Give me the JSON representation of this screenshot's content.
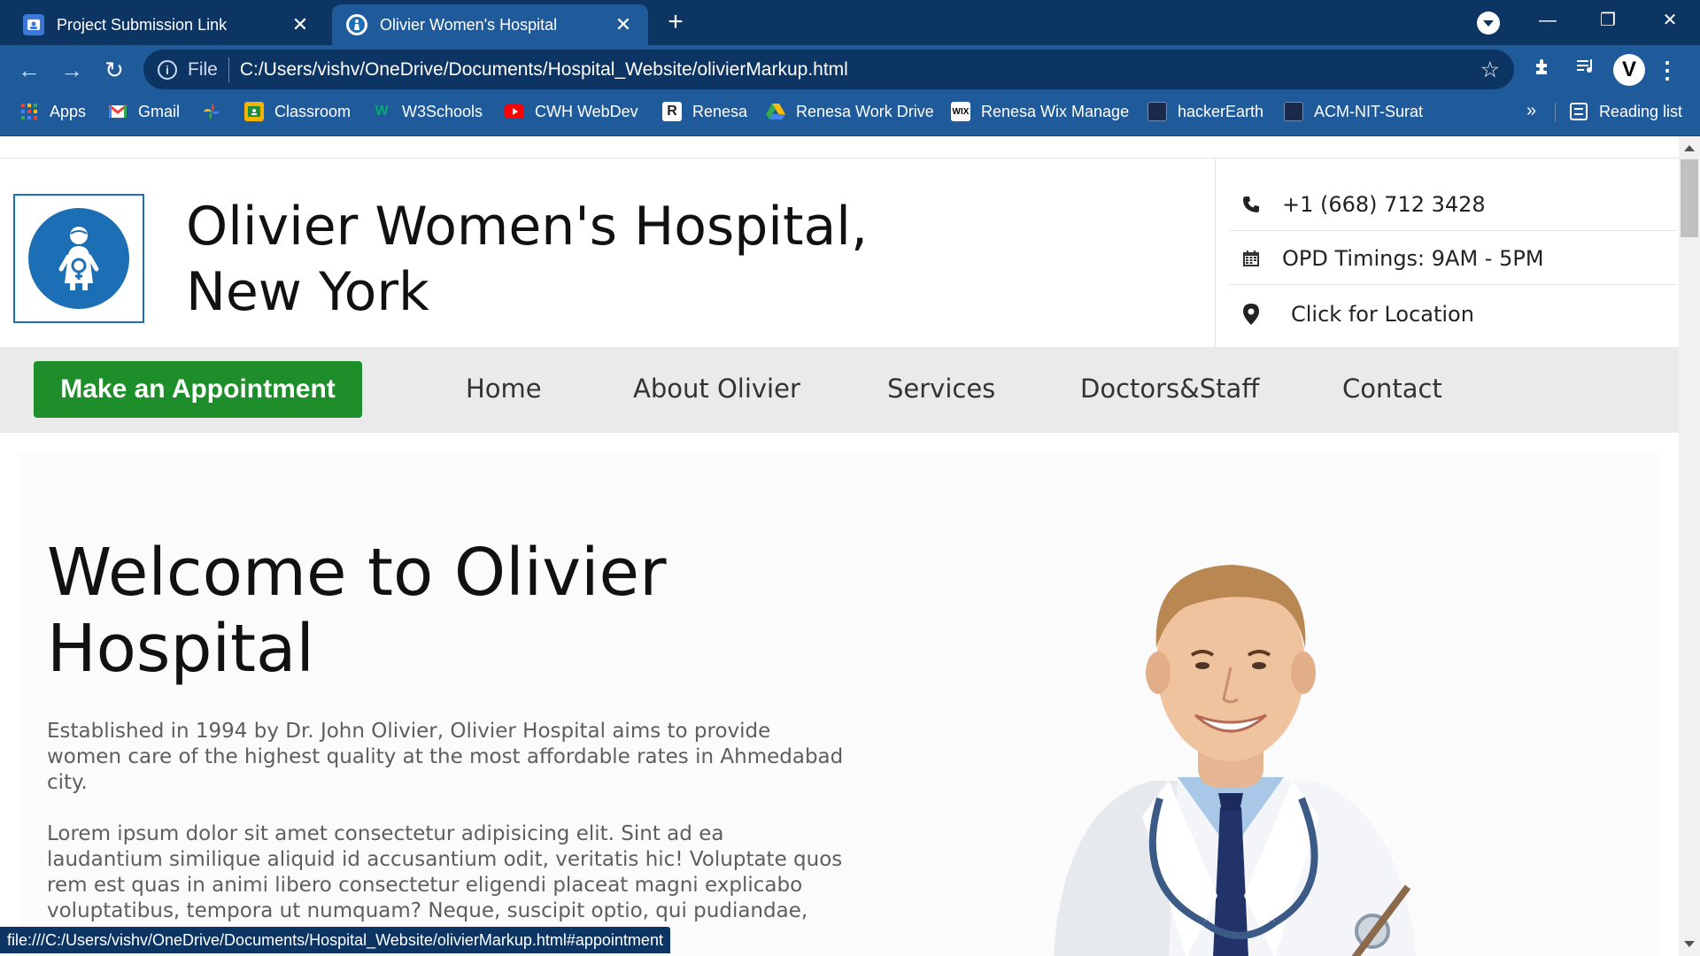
{
  "browser": {
    "tabs": [
      {
        "title": "Project Submission Link",
        "active": false,
        "favicon": "classroom-icon"
      },
      {
        "title": "Olivier Women's Hospital",
        "active": true,
        "favicon": "hospital-icon"
      }
    ],
    "address": {
      "scheme": "File",
      "url": "C:/Users/vishv/OneDrive/Documents/Hospital_Website/olivierMarkup.html"
    },
    "profile_letter": "V",
    "bookmarks": [
      {
        "label": "Apps",
        "icon": "apps-grid-icon"
      },
      {
        "label": "Gmail",
        "icon": "gmail-icon"
      },
      {
        "label": "",
        "icon": "google-photos-icon"
      },
      {
        "label": "Classroom",
        "icon": "classroom-icon"
      },
      {
        "label": "W3Schools",
        "icon": "w3schools-icon"
      },
      {
        "label": "CWH WebDev",
        "icon": "youtube-icon"
      },
      {
        "label": "Renesa",
        "icon": "renesa-icon"
      },
      {
        "label": "Renesa Work Drive",
        "icon": "google-drive-icon"
      },
      {
        "label": "Renesa Wix Manage",
        "icon": "wix-icon"
      },
      {
        "label": "hackerEarth",
        "icon": "hackerearth-icon"
      },
      {
        "label": "ACM-NIT-Surat",
        "icon": "acm-icon"
      }
    ],
    "reading_list": "Reading list",
    "status_url": "file:///C:/Users/vishv/OneDrive/Documents/Hospital_Website/olivierMarkup.html#appointment",
    "colors": {
      "tabbar": "#0d3563",
      "toolbar": "#1f5a9a"
    }
  },
  "site": {
    "title_line1": "Olivier Women's Hospital,",
    "title_line2": "New York",
    "logo_icon": "pregnant-woman-icon",
    "contact": {
      "phone": "+1 (668) 712 3428",
      "timings": "OPD Timings: 9AM - 5PM",
      "location": "Click for Location"
    },
    "nav": {
      "appointment": "Make an Appointment",
      "links": [
        "Home",
        "About Olivier",
        "Services",
        "Doctors&Staff",
        "Contact"
      ]
    },
    "hero": {
      "heading_line1": "Welcome to Olivier",
      "heading_line2": "Hospital",
      "para1": "Established in 1994 by Dr. John Olivier, Olivier Hospital aims to provide women care of the highest quality at the most affordable rates in Ahmedabad city.",
      "para2": "Lorem ipsum dolor sit amet consectetur adipisicing elit. Sint ad ea laudantium similique aliquid id accusantium odit, veritatis hic! Voluptate quos rem est quas in animi libero consectetur eligendi placeat magni explicabo voluptatibus, tempora ut numquam? Neque, suscipit optio, qui pudiandae,"
    },
    "colors": {
      "brand_blue": "#1c6fb4",
      "appointment_green": "#1e8e2a",
      "nav_bg": "#eaeaea"
    }
  }
}
